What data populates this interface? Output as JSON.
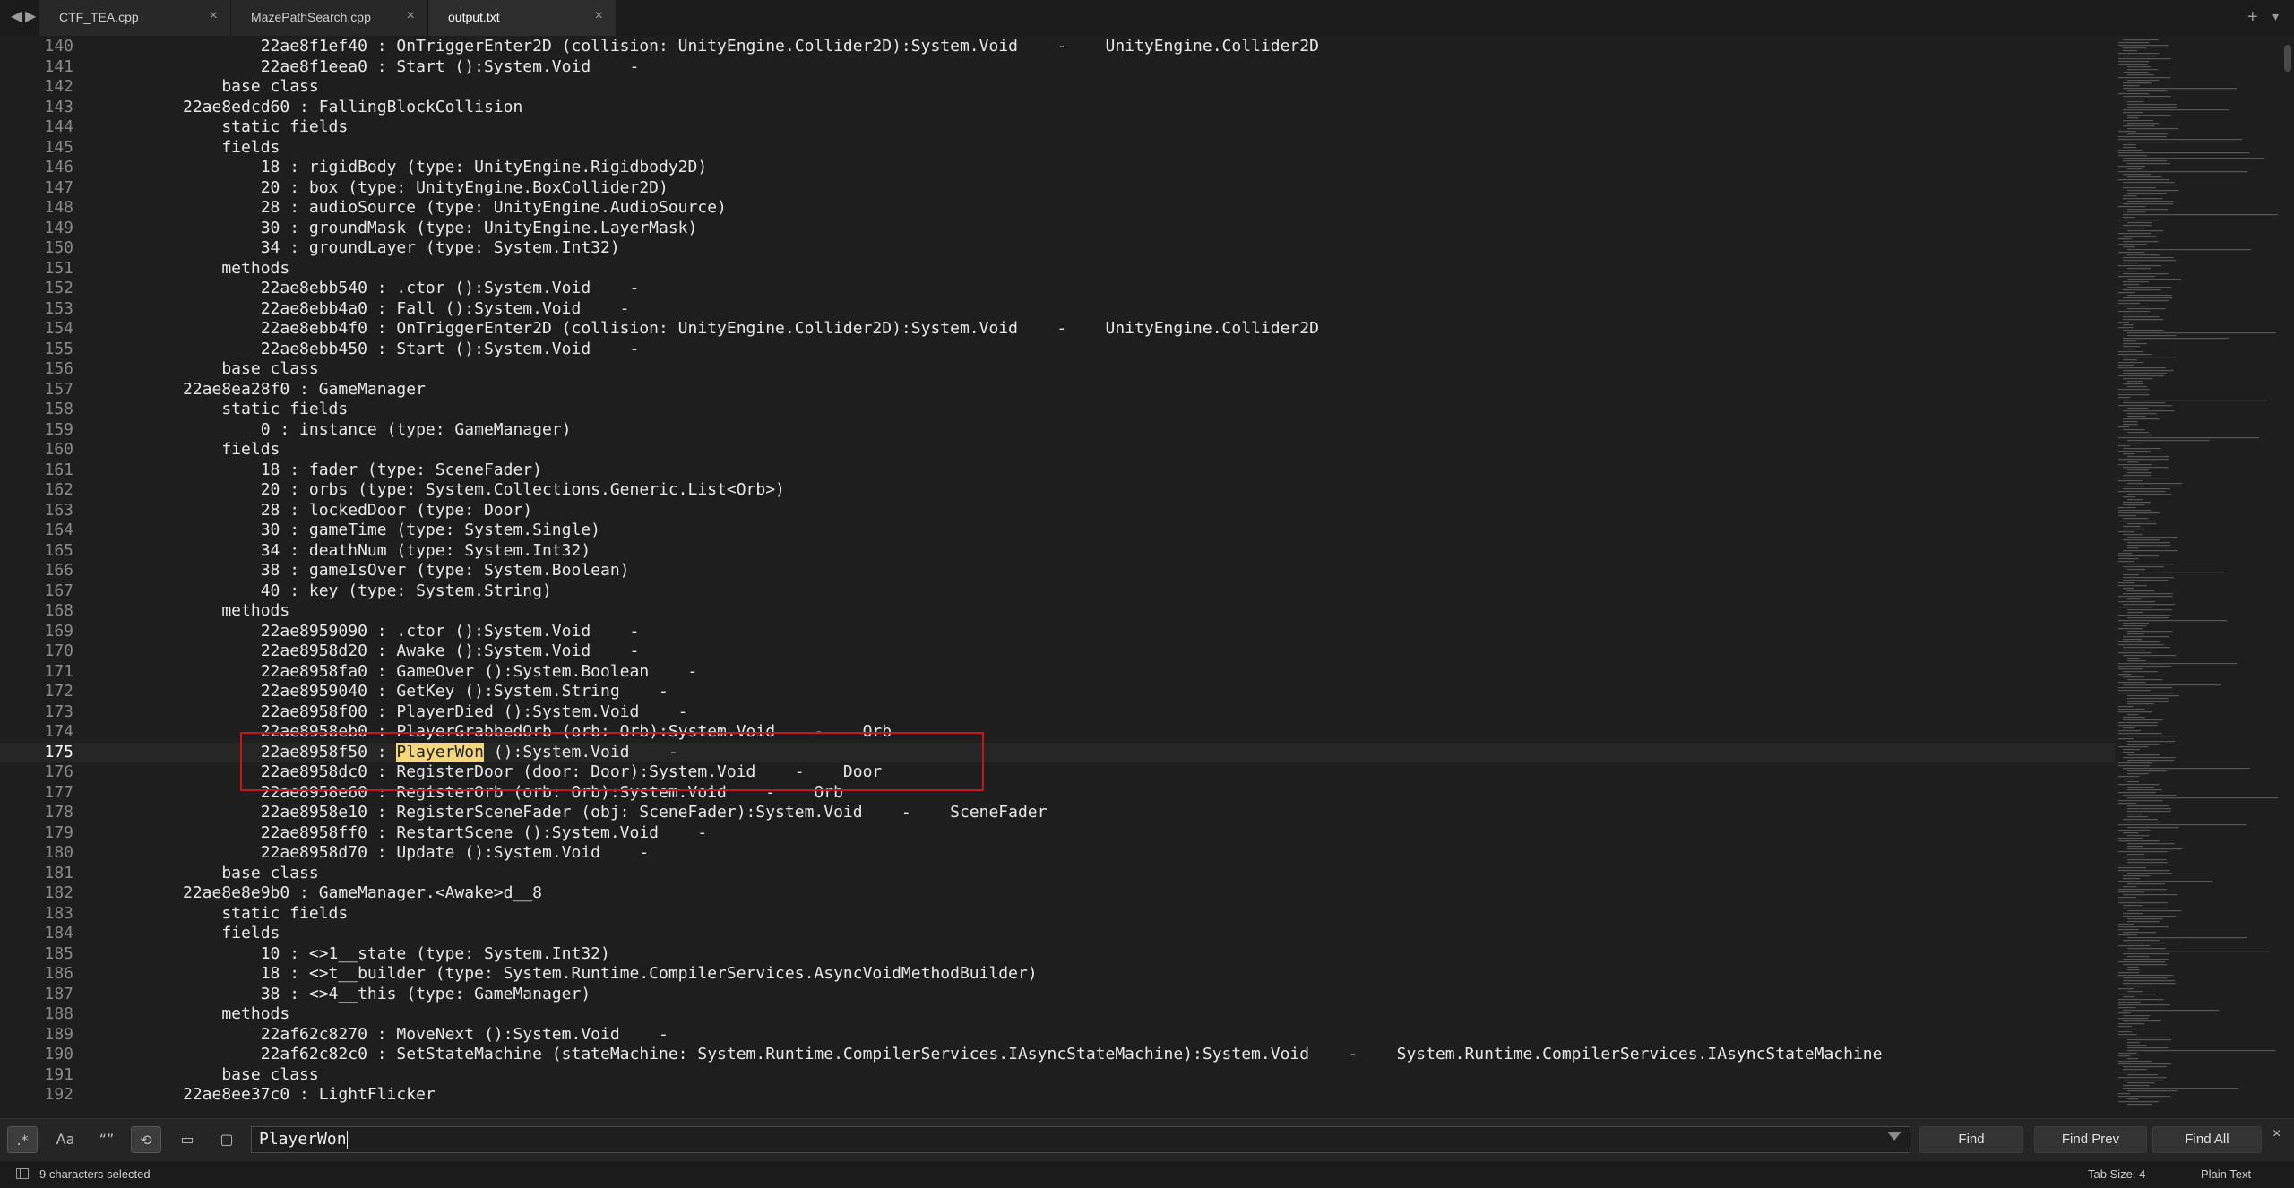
{
  "tabs": [
    {
      "label": "CTF_TEA.cpp",
      "active": false
    },
    {
      "label": "MazePathSearch.cpp",
      "active": false
    },
    {
      "label": "output.txt",
      "active": true
    }
  ],
  "tabbar": {
    "nav_back_icon": "◀",
    "nav_forward_icon": "▶",
    "close_icon": "×",
    "plus_icon": "+",
    "more_icon": "▾"
  },
  "editor": {
    "first_line": 140,
    "current_line": 175,
    "lines": [
      "        22ae8f1ef40 : OnTriggerEnter2D (collision: UnityEngine.Collider2D):System.Void    -    UnityEngine.Collider2D",
      "        22ae8f1eea0 : Start ():System.Void    -",
      "    base class",
      "22ae8edcd60 : FallingBlockCollision",
      "    static fields",
      "    fields",
      "        18 : rigidBody (type: UnityEngine.Rigidbody2D)",
      "        20 : box (type: UnityEngine.BoxCollider2D)",
      "        28 : audioSource (type: UnityEngine.AudioSource)",
      "        30 : groundMask (type: UnityEngine.LayerMask)",
      "        34 : groundLayer (type: System.Int32)",
      "    methods",
      "        22ae8ebb540 : .ctor ():System.Void    -",
      "        22ae8ebb4a0 : Fall ():System.Void    -",
      "        22ae8ebb4f0 : OnTriggerEnter2D (collision: UnityEngine.Collider2D):System.Void    -    UnityEngine.Collider2D",
      "        22ae8ebb450 : Start ():System.Void    -",
      "    base class",
      "22ae8ea28f0 : GameManager",
      "    static fields",
      "        0 : instance (type: GameManager)",
      "    fields",
      "        18 : fader (type: SceneFader)",
      "        20 : orbs (type: System.Collections.Generic.List<Orb>)",
      "        28 : lockedDoor (type: Door)",
      "        30 : gameTime (type: System.Single)",
      "        34 : deathNum (type: System.Int32)",
      "        38 : gameIsOver (type: System.Boolean)",
      "        40 : key (type: System.String)",
      "    methods",
      "        22ae8959090 : .ctor ():System.Void    -",
      "        22ae8958d20 : Awake ():System.Void    -",
      "        22ae8958fa0 : GameOver ():System.Boolean    -",
      "        22ae8959040 : GetKey ():System.String    -",
      "        22ae8958f00 : PlayerDied ():System.Void    -",
      "        22ae8958eb0 : PlayerGrabbedOrb (orb: Orb):System.Void    -    Orb",
      "        22ae8958f50 : PlayerWon ():System.Void    -",
      "        22ae8958dc0 : RegisterDoor (door: Door):System.Void    -    Door",
      "        22ae8958e60 : RegisterOrb (orb: Orb):System.Void    -    Orb",
      "        22ae8958e10 : RegisterSceneFader (obj: SceneFader):System.Void    -    SceneFader",
      "        22ae8958ff0 : RestartScene ():System.Void    -",
      "        22ae8958d70 : Update ():System.Void    -",
      "    base class",
      "22ae8e8e9b0 : GameManager.<Awake>d__8",
      "    static fields",
      "    fields",
      "        10 : <>1__state (type: System.Int32)",
      "        18 : <>t__builder (type: System.Runtime.CompilerServices.AsyncVoidMethodBuilder)",
      "        38 : <>4__this (type: GameManager)",
      "    methods",
      "        22af62c8270 : MoveNext ():System.Void    -",
      "        22af62c82c0 : SetStateMachine (stateMachine: System.Runtime.CompilerServices.IAsyncStateMachine):System.Void    -    System.Runtime.CompilerServices.IAsyncStateMachine",
      "    base class",
      "22ae8ee37c0 : LightFlicker"
    ],
    "found_line_prefix": "        22ae8958f50 : ",
    "found_match": "PlayerWon",
    "found_line_suffix": " ():System.Void    -"
  },
  "find": {
    "regex_label": ".*",
    "case_label": "Aa",
    "word_label": "“”",
    "wrap_label": "⟲",
    "in_selection_label": "▭",
    "highlight_label": "▢",
    "query": "PlayerWon",
    "find_label": "Find",
    "find_prev_label": "Find Prev",
    "find_all_label": "Find All",
    "close_icon": "×"
  },
  "status": {
    "selection": "9 characters selected",
    "tab_size": "Tab Size: 4",
    "syntax": "Plain Text"
  },
  "colors": {
    "highlight": "#f5d77a",
    "annotation_box": "#c51818",
    "background": "#1e1e1e"
  }
}
